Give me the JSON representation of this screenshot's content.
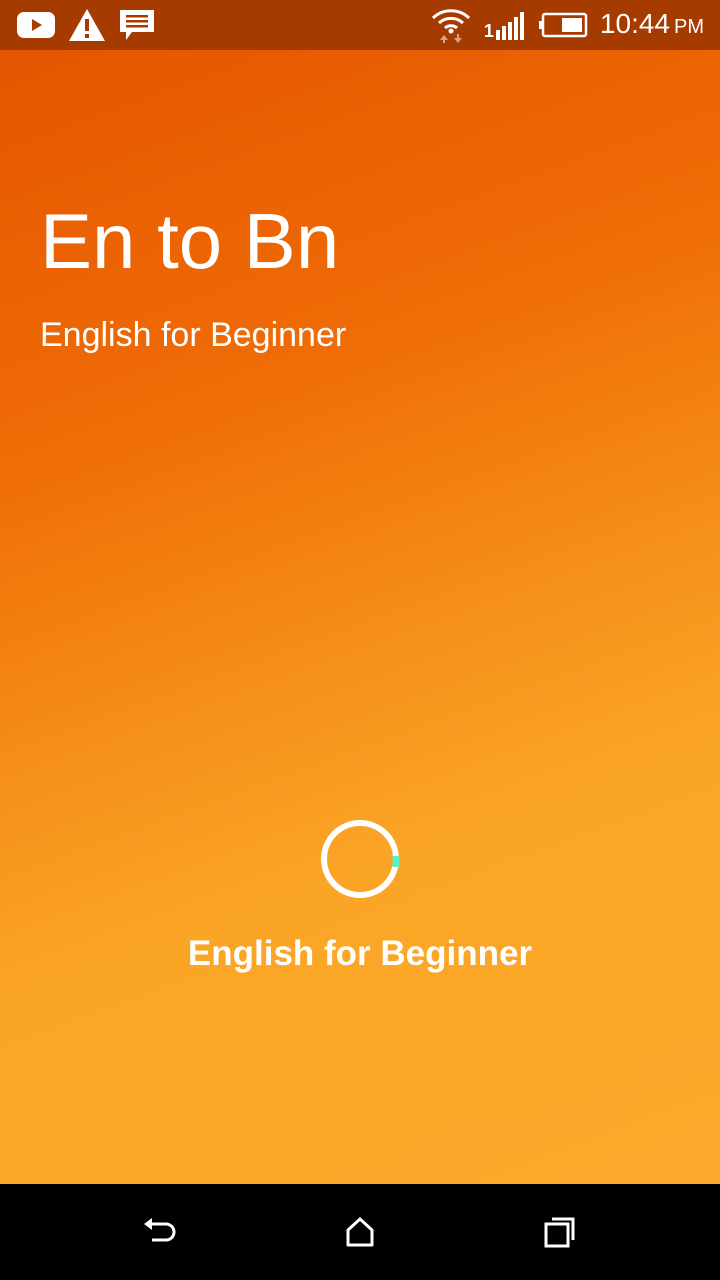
{
  "status_bar": {
    "icons_left": [
      "youtube-icon",
      "warning-icon",
      "message-icon"
    ],
    "icons_right": [
      "wifi-icon",
      "signal-icon",
      "battery-icon"
    ],
    "signal_sim_label": "1",
    "time": "10:44",
    "ampm": "PM",
    "colors": {
      "background": "#a63b00",
      "foreground": "#ffffff"
    }
  },
  "splash": {
    "title": "En to Bn",
    "subtitle": "English for Beginner",
    "loading_label": "English for Beginner",
    "colors": {
      "gradient_start": "#e65500",
      "gradient_end": "#fda82a",
      "text": "#ffffff",
      "spinner_ring": "#ffffff",
      "spinner_accent": "#5ef0c0"
    }
  },
  "nav_bar": {
    "icons": [
      "back-icon",
      "home-icon",
      "recents-icon"
    ]
  }
}
